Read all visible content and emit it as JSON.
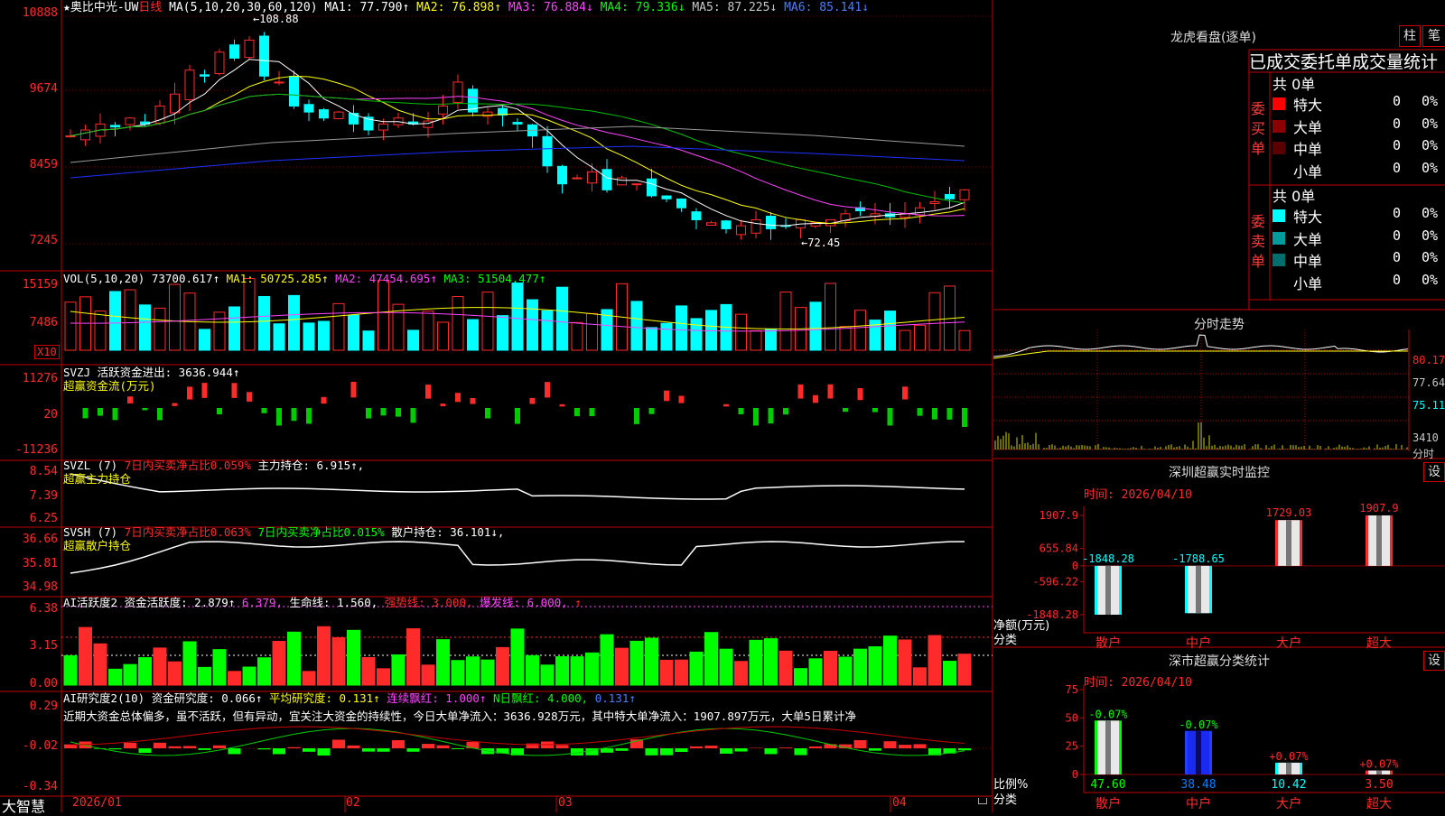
{
  "colors": {
    "up": "#ff2a2a",
    "down": "#00ffff",
    "grid": "#c00000",
    "ma1": "#ffffff",
    "ma2": "#ffff00",
    "ma3": "#ff44ff",
    "ma4": "#00c000",
    "ma5": "#9a9a9a",
    "ma6": "#2030ff"
  },
  "header": {
    "star": "★",
    "stock": "奥比中光-UW",
    "period": "日线",
    "ma_params": "MA(5,10,20,30,60,120)",
    "ma1": "MA1: 77.790↑",
    "ma2": "MA2: 76.898↑",
    "ma3": "MA3: 76.884↓",
    "ma4": "MA4: 79.336↓",
    "ma5": "MA5: 87.225↓",
    "ma6": "MA6: 85.141↓"
  },
  "price_axis": [
    "10888",
    "9674",
    "8459",
    "7245"
  ],
  "price_marks": {
    "high": "←108.88",
    "low": "←72.45"
  },
  "vol": {
    "label": "VOL(5,10,20)",
    "value": "73700.617↑",
    "ma1": "MA1: 50725.285↑",
    "ma2": "MA2: 47454.695↑",
    "ma3": "MA3: 51504.477↑",
    "axis": [
      "15159",
      "7486"
    ],
    "unit": "X10"
  },
  "svzj": {
    "label": "SVZJ  活跃资金进出: 3636.944↑",
    "sub": "超赢资金流(万元)",
    "axis": [
      "11276",
      "20",
      "-11236"
    ]
  },
  "svzl": {
    "label": "SVZL (7)",
    "pct": "7日内买卖净占比0.059%",
    "hold": "主力持仓: 6.915↑,",
    "sub": "超赢主力持仓",
    "axis": [
      "8.54",
      "7.39",
      "6.25"
    ]
  },
  "svsh": {
    "label": "SVSH (7)",
    "pct1": "7日内买卖净占比0.063%",
    "pct2": "7日内买卖净占比0.015%",
    "hold": "散户持仓: 36.101↓,",
    "sub": "超赢散户持仓",
    "axis": [
      "36.66",
      "35.81",
      "34.98"
    ]
  },
  "ai_act": {
    "label": "AI活跃度2",
    "act": "资金活跃度: 2.879↑",
    "v2": "6.379,",
    "life": "生命线: 1.560,",
    "strong": "强势线: 3.000,",
    "burst": "爆发线: 6.000,",
    "arrow": "↑",
    "axis": [
      "6.38",
      "3.15",
      "0.00"
    ]
  },
  "ai_res": {
    "label": "AI研究度2(10)",
    "res": "资金研究度: 0.066↑",
    "avg": "平均研究度: 0.131↑",
    "cont": "连续飘红: 1.000↑",
    "nday": "N日飘红: 4.000,",
    "last": "0.131↑",
    "comment": "近期大资金总体偏多，虽不活跃，但有异动，宜关注大资金的持续性，今日大单净流入：3636.928万元，其中特大单净流入：1907.897万元，大单5日累计净",
    "axis": [
      "0.29",
      "-0.02",
      "-0.34"
    ]
  },
  "date_axis": {
    "brand": "大智慧",
    "labels": [
      "2026/01",
      "02",
      "03",
      "04"
    ]
  },
  "lhb": {
    "title": "龙虎看盘(逐单)",
    "btn1": "柱",
    "btn2": "笔",
    "head": "已成交委托单成交量统计",
    "buy": {
      "side": "委买单",
      "total": "共 0单",
      "rows": [
        {
          "name": "特大",
          "n": "0",
          "pct": "0%",
          "color": "#ff0000"
        },
        {
          "name": "大单",
          "n": "0",
          "pct": "0%",
          "color": "#8b0000"
        },
        {
          "name": "中单",
          "n": "0",
          "pct": "0%",
          "color": "#5a0000"
        },
        {
          "name": "小单",
          "n": "0",
          "pct": "0%",
          "color": "#000000"
        }
      ]
    },
    "sell": {
      "side": "委卖单",
      "total": "共 0单",
      "rows": [
        {
          "name": "特大",
          "n": "0",
          "pct": "0%",
          "color": "#00ffff"
        },
        {
          "name": "大单",
          "n": "0",
          "pct": "0%",
          "color": "#009a9a"
        },
        {
          "name": "中单",
          "n": "0",
          "pct": "0%",
          "color": "#006e6e"
        },
        {
          "name": "小单",
          "n": "0",
          "pct": "0%",
          "color": "#000000"
        }
      ]
    }
  },
  "intraday": {
    "title": "分时走势",
    "axis": [
      "80.17",
      "77.64",
      "75.11",
      "3410",
      "分时"
    ]
  },
  "monitor": {
    "title": "深圳超赢实时监控",
    "set": "设",
    "time": "时间: 2026/04/10",
    "ylabel": "净额(万元)",
    "xlabel": "分类",
    "axis": [
      "1907.9",
      "655.84",
      "0",
      "-596.22",
      "-1848.28"
    ],
    "chart_data": {
      "type": "bar",
      "categories": [
        "散户",
        "中户",
        "大户",
        "超大"
      ],
      "values": [
        -1848.28,
        -1788.65,
        1729.03,
        1907.9
      ],
      "labels": [
        "-1848.28",
        "-1788.65",
        "1729.03",
        "1907.9"
      ],
      "ylim": [
        -1848.28,
        1907.9
      ]
    }
  },
  "classify": {
    "title": "深市超赢分类统计",
    "set": "设",
    "time": "时间: 2026/04/10",
    "ylabel": "比例%",
    "xlabel": "分类",
    "axis": [
      "75",
      "50",
      "25",
      "0"
    ],
    "chart_data": {
      "type": "bar",
      "categories": [
        "散户",
        "中户",
        "大户",
        "超大"
      ],
      "values": [
        47.6,
        38.48,
        10.42,
        3.5
      ],
      "labels": [
        "47.60",
        "38.48",
        "10.42",
        "3.50"
      ],
      "changes": [
        "-0.07%",
        "-0.07%",
        "+0.07%",
        "+0.07%"
      ],
      "ylim": [
        0,
        75
      ]
    }
  }
}
